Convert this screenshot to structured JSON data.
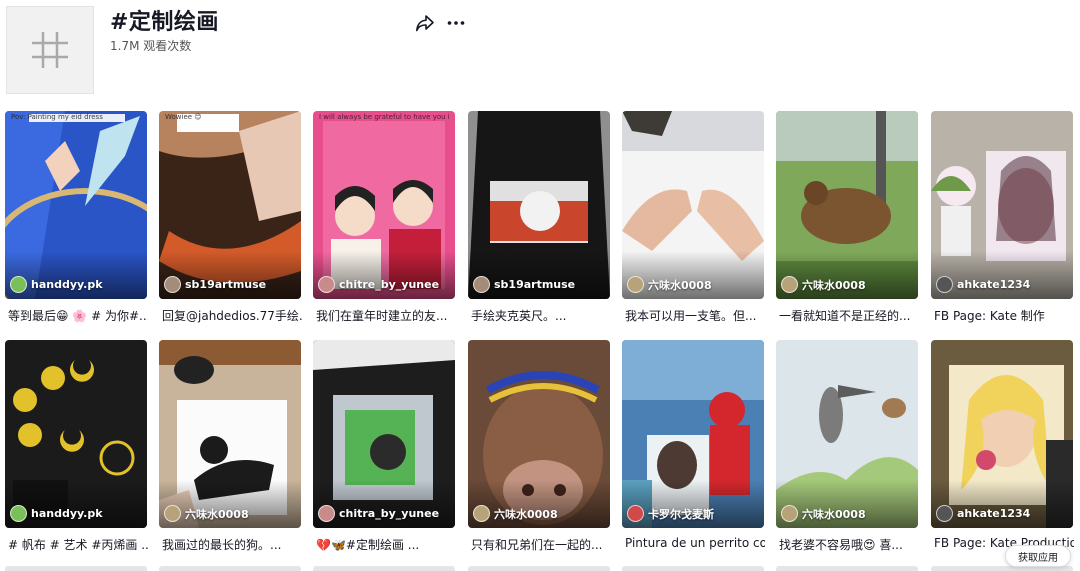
{
  "header": {
    "title": "#定制绘画",
    "views": "1.7M 观看次数"
  },
  "rows": [
    [
      {
        "creator": "handdyy.pk",
        "caption": "等到最后😁 🌸 # 为你#...",
        "overlay_text": "Pov: Painting my eid dress",
        "avatar_color": "#7bbf5a"
      },
      {
        "creator": "sb19artmuse",
        "caption": "回复@jahdedios.77手绘...",
        "overlay_text": "Wowiee 😊",
        "avatar_color": "#a58c7a"
      },
      {
        "creator": "chitre_by_yunee",
        "caption": "我们在童年时建立的友...",
        "overlay_text": "I will always be grateful to have you in my life",
        "avatar_color": "#c98a8a"
      },
      {
        "creator": "sb19artmuse",
        "caption": "手绘夹克英尺。...",
        "overlay_text": "",
        "avatar_color": "#a58c7a"
      },
      {
        "creator": "六味水0008",
        "caption": "我本可以用一支笔。但...",
        "overlay_text": "",
        "avatar_color": "#b8a27a"
      },
      {
        "creator": "六味水0008",
        "caption": "一看就知道不是正经的...",
        "overlay_text": "",
        "avatar_color": "#b8a27a"
      },
      {
        "creator": "ahkate1234",
        "caption": "FB Page: Kate 制作",
        "overlay_text": "",
        "avatar_color": "#555"
      }
    ],
    [
      {
        "creator": "handdyy.pk",
        "caption": "# 帆布 # 艺术 #丙烯画 ...",
        "overlay_text": "",
        "avatar_color": "#7bbf5a"
      },
      {
        "creator": "六味水0008",
        "caption": "我画过的最长的狗。...",
        "overlay_text": "",
        "avatar_color": "#b8a27a"
      },
      {
        "creator": "chitra_by_yunee",
        "caption": "💔🦋#定制绘画 ...",
        "overlay_text": "",
        "avatar_color": "#c98a8a"
      },
      {
        "creator": "六味水0008",
        "caption": "只有和兄弟们在一起的...",
        "overlay_text": "",
        "avatar_color": "#b8a27a"
      },
      {
        "creator": "卡罗尔戈麦斯",
        "caption": "Pintura de un perrito co...",
        "overlay_text": "",
        "avatar_color": "#d04a4a"
      },
      {
        "creator": "六味水0008",
        "caption": "找老婆不容易哦😍 喜...",
        "overlay_text": "",
        "avatar_color": "#b8a27a"
      },
      {
        "creator": "ahkate1234",
        "caption": "FB Page: Kate Production",
        "overlay_text": "",
        "avatar_color": "#555"
      }
    ]
  ],
  "get_app_button": "获取应用"
}
